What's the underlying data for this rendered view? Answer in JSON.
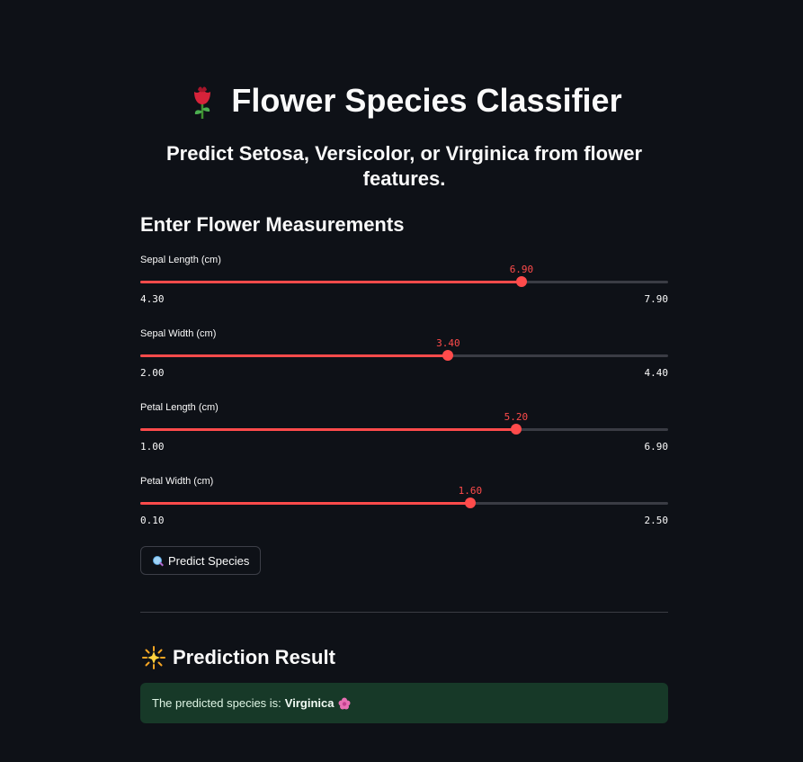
{
  "header": {
    "title": "Flower Species Classifier",
    "title_icon": "rose-icon",
    "subtitle": "Predict Setosa, Versicolor, or Virginica from flower features."
  },
  "form": {
    "section_title": "Enter Flower Measurements",
    "sliders": [
      {
        "label": "Sepal Length (cm)",
        "value": "6.90",
        "min": "4.30",
        "max": "7.90"
      },
      {
        "label": "Sepal Width (cm)",
        "value": "3.40",
        "min": "2.00",
        "max": "4.40"
      },
      {
        "label": "Petal Length (cm)",
        "value": "5.20",
        "min": "1.00",
        "max": "6.90"
      },
      {
        "label": "Petal Width (cm)",
        "value": "1.60",
        "min": "0.10",
        "max": "2.50"
      }
    ],
    "predict_button": {
      "label": "Predict Species",
      "icon": "magnifying-glass-icon"
    }
  },
  "result": {
    "title": "Prediction Result",
    "title_icon": "sparkle-star-icon",
    "prefix": "The predicted species is:",
    "species": "Virginica",
    "species_icon": "flower-icon"
  },
  "colors": {
    "background": "#0e1117",
    "accent": "#ff4b4b",
    "track": "#3a3c44",
    "success_bg": "#173928"
  }
}
